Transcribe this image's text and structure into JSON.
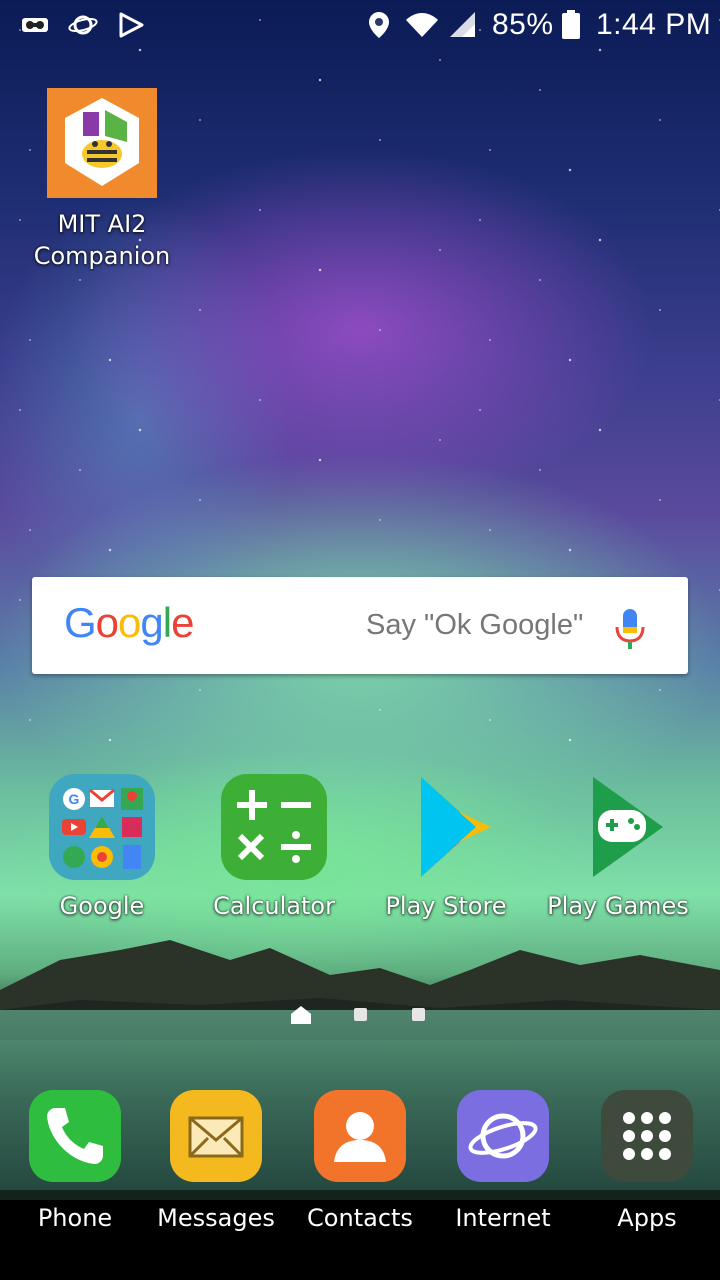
{
  "status_bar": {
    "battery_percent": "85%",
    "time": "1:44 PM",
    "left_icons": [
      "voicemail-icon",
      "saturn-icon",
      "play-icon"
    ],
    "right_icons": [
      "location-icon",
      "wifi-icon",
      "signal-icon",
      "battery-icon"
    ]
  },
  "home": {
    "top_apps": [
      {
        "label": "MIT AI2\nCompanion",
        "line1": "MIT AI2",
        "line2": "Companion",
        "icon": "mit-ai2-companion-icon"
      }
    ],
    "search_widget": {
      "logo_text": "Google",
      "hint": "Say \"Ok Google\"",
      "mic_icon": "mic-icon"
    },
    "apps_row": [
      {
        "label": "Google",
        "icon": "google-folder-icon"
      },
      {
        "label": "Calculator",
        "icon": "calculator-icon"
      },
      {
        "label": "Play Store",
        "icon": "play-store-icon"
      },
      {
        "label": "Play Games",
        "icon": "play-games-icon"
      }
    ],
    "page_indicator": {
      "pages": 3,
      "current": "home"
    }
  },
  "dock": [
    {
      "label": "Phone",
      "icon": "phone-icon"
    },
    {
      "label": "Messages",
      "icon": "messages-icon"
    },
    {
      "label": "Contacts",
      "icon": "contacts-icon"
    },
    {
      "label": "Internet",
      "icon": "internet-icon"
    },
    {
      "label": "Apps",
      "icon": "apps-grid-icon"
    }
  ],
  "colors": {
    "google_blue": "#4285F4",
    "google_red": "#EA4335",
    "google_yellow": "#FBBC05",
    "google_green": "#34A853"
  }
}
